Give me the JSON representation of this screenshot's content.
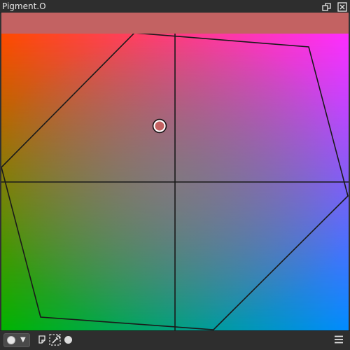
{
  "window": {
    "title": "Pigment.O"
  },
  "canvas": {
    "header_color": "#c36262",
    "selected_color": "#c36262",
    "gradient_colors": {
      "top_left": "#ff4a00",
      "top_right": "#ff2dff",
      "bottom_left": "#00b400",
      "bottom_right": "#008cff"
    }
  },
  "toolbar": {
    "shape_selector": {
      "icon": "circle-icon",
      "caret": "▼"
    },
    "icons": [
      "note-icon",
      "eyedropper-select-icon",
      "dot-icon",
      "menu-icon"
    ]
  }
}
